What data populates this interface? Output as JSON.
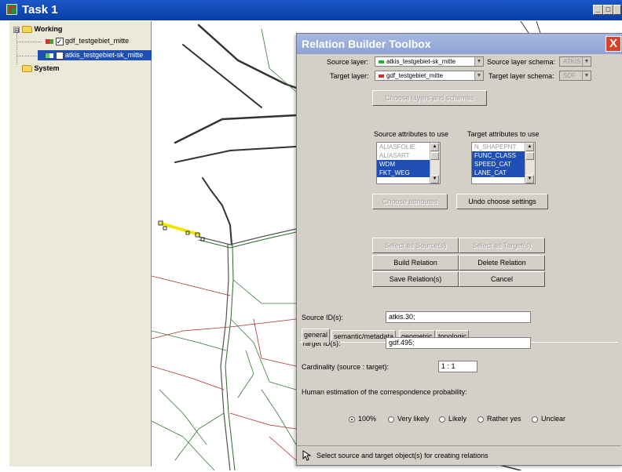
{
  "window": {
    "title": "Task 1",
    "minimize": "_",
    "restore": "□",
    "close": "×"
  },
  "tree": {
    "working": "Working",
    "layer1": "gdf_testgebiet_mitte",
    "layer2": "atkis_testgebiet-sk_mitte",
    "system": "System",
    "expand_working": "⊟",
    "expand_system": "⊞"
  },
  "dialog": {
    "title": "Relation Builder Toolbox",
    "close": "X",
    "source_layer_label": "Source layer:",
    "source_layer_value": "atkis_testgebiet-sk_mitte",
    "source_schema_label": "Source layer schema:",
    "source_schema_value": "ATKIS",
    "target_layer_label": "Target layer:",
    "target_layer_value": "gdf_testgebiet_mitte",
    "target_schema_label": "Target layer schema:",
    "target_schema_value": "SDF",
    "choose_layers_btn": "Choose layers and schemas",
    "source_attrs_label": "Source attributes to use",
    "target_attrs_label": "Target attributes to use",
    "source_attrs": [
      {
        "label": "ALIASFOLIE",
        "state": "dim"
      },
      {
        "label": "ALIASART",
        "state": "dim"
      },
      {
        "label": "WDM",
        "state": "sel"
      },
      {
        "label": "FKT_WEG",
        "state": "sel"
      }
    ],
    "target_attrs": [
      {
        "label": "N_SHAPEPNT",
        "state": "dim"
      },
      {
        "label": "FUNC_CLASS",
        "state": "sel"
      },
      {
        "label": "SPEED_CAT",
        "state": "sel"
      },
      {
        "label": "LANE_CAT",
        "state": "sel"
      }
    ],
    "choose_attrs_btn": "Choose attributes",
    "undo_btn": "Undo choose settings",
    "select_source_btn": "Select as Source(s)",
    "select_target_btn": "Select as Target(s)",
    "build_btn": "Build Relation",
    "delete_btn": "Delete Relation",
    "save_btn": "Save Relation(s)",
    "cancel_btn": "Cancel",
    "tabs": [
      "general",
      "semantic/metadata",
      "geometric",
      "topologic"
    ],
    "source_id_label": "Source ID(s):",
    "source_id_value": "atkis.30;",
    "target_id_label": "Target ID(s):",
    "target_id_value": "gdf.495;",
    "cardinality_label": "Cardinality (source : target):",
    "cardinality_value": "1 : 1",
    "estimation_label": "Human estimation of the correspondence probability:",
    "options": [
      "100%",
      "Very likely",
      "Likely",
      "Rather yes",
      "Unclear"
    ],
    "selected_option": "100%",
    "status_text": "Select source and target object(s) for creating relations"
  },
  "colors": {
    "titlebar": "#0a3ea6",
    "selection": "#1f4fb4",
    "highlight_road": "#f2e600",
    "road_red": "#b03030",
    "road_green": "#3a7a3a"
  }
}
